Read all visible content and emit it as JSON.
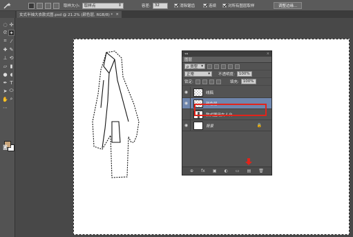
{
  "options_bar": {
    "sample_size_label": "取样大小:",
    "sample_size_value": "取样点",
    "tolerance_label": "容差:",
    "tolerance_value": "32",
    "antialias_label": "消除锯齿",
    "contiguous_label": "连续",
    "sample_all_label": "对所有图层取样",
    "refine_edge_button": "调整边缘..."
  },
  "document_tab": {
    "title": "女式半袖大衣款式图.psd @ 21.2% (颜色层, RGB/8) *",
    "close": "×"
  },
  "layers_panel": {
    "title": "图层",
    "collapse": "◂◂",
    "close": "×",
    "kind_filter": "ρ 类型",
    "blend_mode": "正常",
    "opacity_label": "不透明度:",
    "opacity_value": "100%",
    "lock_label": "锁定:",
    "fill_label": "填充:",
    "fill_value": "100%",
    "layers": [
      {
        "name": "线稿",
        "visible": true,
        "thumb": "checker",
        "selected": false
      },
      {
        "name": "颜色层",
        "visible": true,
        "thumb": "checker",
        "selected": true
      },
      {
        "name": "款式图用女人台",
        "visible": false,
        "thumb": "figure",
        "selected": false
      },
      {
        "name": "背景",
        "visible": true,
        "thumb": "white",
        "selected": false
      }
    ],
    "bottom_icons": [
      "link-icon",
      "fx-icon",
      "mask-icon",
      "adjustment-icon",
      "folder-icon",
      "new-layer-icon",
      "trash-icon"
    ],
    "bottom_glyphs": [
      "⊕",
      "fx",
      "▣",
      "◐",
      "▭",
      "▤",
      "🗑"
    ]
  },
  "colors": {
    "foreground": "#c9a57a",
    "background": "#ffffff",
    "highlight_red": "#e2231a",
    "selected_layer": "#6f86ad"
  }
}
